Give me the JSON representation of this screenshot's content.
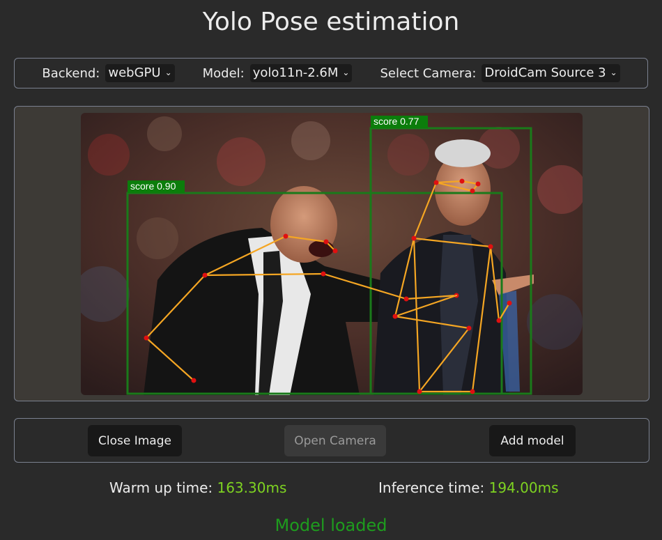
{
  "title": "Yolo Pose estimation",
  "controls": {
    "backend_label": "Backend:",
    "backend_value": "webGPU",
    "model_label": "Model:",
    "model_value": "yolo11n-2.6M",
    "camera_label": "Select Camera:",
    "camera_value": "DroidCam Source 3"
  },
  "detections": [
    {
      "label": "score 0.90"
    },
    {
      "label": "score 0.77"
    }
  ],
  "buttons": {
    "close_image": "Close Image",
    "open_camera": "Open Camera",
    "add_model": "Add model"
  },
  "metrics": {
    "warmup_label": "Warm up time:",
    "warmup_value": "163.30ms",
    "inference_label": "Inference time:",
    "inference_value": "194.00ms"
  },
  "status": "Model loaded",
  "colors": {
    "box": "#1a7a1a",
    "skeleton": "#f5a623",
    "keypoint": "#e01010",
    "metric_value": "#7ed321",
    "status": "#1e9c1e"
  }
}
